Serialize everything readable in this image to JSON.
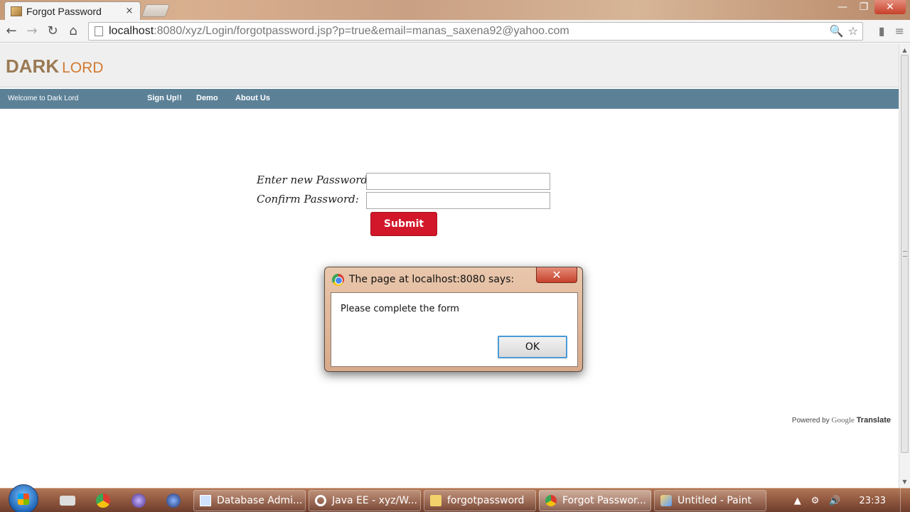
{
  "browser": {
    "tab_title": "Forgot Password",
    "tab_close": "×",
    "url_host": "localhost",
    "url_rest": ":8080/xyz/Login/forgotpassword.jsp?p=true&email=manas_saxena92@yahoo.com",
    "window_controls": {
      "minimize": "—",
      "maximize": "❐",
      "close": "✕"
    },
    "nav": {
      "back": "←",
      "forward": "→",
      "reload": "↻",
      "home": "⌂"
    },
    "omni_icons": {
      "search": "🔍",
      "bookmark": "☆"
    }
  },
  "site": {
    "logo_main": "DARK",
    "logo_sub": "LORD",
    "welcome": "Welcome to Dark Lord",
    "nav_links": [
      "Sign Up!!",
      "Demo",
      "About Us"
    ]
  },
  "form": {
    "new_password_label": "Enter new Password:",
    "confirm_password_label": "Confirm Password:",
    "submit_label": "Submit"
  },
  "footer": {
    "powered_by": "Powered by",
    "google": "Google",
    "translate": "Translate"
  },
  "dialog": {
    "title": "The page at localhost:8080 says:",
    "close": "✕",
    "message": "Please complete the form",
    "ok_label": "OK"
  },
  "taskbar": {
    "items": [
      {
        "label": "Database Admi...",
        "active": false
      },
      {
        "label": "Java EE - xyz/W...",
        "active": false
      },
      {
        "label": "forgotpassword",
        "active": false
      },
      {
        "label": "Forgot Passwor...",
        "active": true
      },
      {
        "label": "Untitled - Paint",
        "active": false
      }
    ],
    "tray": {
      "show_hidden": "▲",
      "settings": "⚙",
      "volume": "🔊"
    },
    "clock": "23:33"
  },
  "colors": {
    "navbar": "#5c8197",
    "submit": "#d3172a",
    "logo_main": "#9a7a54",
    "logo_sub": "#d27a30"
  }
}
